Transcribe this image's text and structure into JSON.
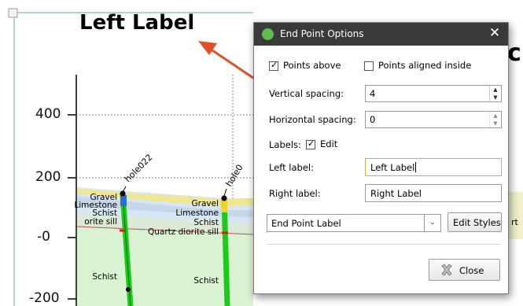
{
  "background": {
    "left_label": "Left Label",
    "right_title_fragment": "c",
    "far_right_fragment": "rt",
    "y_ticks": [
      "400",
      "200",
      "-0",
      "-200"
    ],
    "hole_labels": [
      "hole022",
      "hole0"
    ],
    "strata_left": [
      "Gravel",
      "Limestone",
      "Schist",
      "orite sill",
      "Schist"
    ],
    "strata_right": [
      "Gravel",
      "Limestone",
      "Schist",
      "Quartz diorite sill",
      "Schist"
    ],
    "colors": {
      "annotation_arrow": "#e0502a",
      "gravel": "#f2e68a",
      "limestone": "#c9d6ea",
      "schist_band": "#d5e7f4",
      "lower_schist": "#d9f2d1",
      "drillhole": "#1ec91e",
      "sill_line": "#d22020",
      "frame_border": "#a8d8d2"
    }
  },
  "dialog": {
    "title": "End Point Options",
    "close_glyph": "✕",
    "points_above_label": "Points above",
    "points_above_checked": true,
    "points_aligned_label": "Points aligned inside",
    "points_aligned_checked": false,
    "vertical_spacing_label": "Vertical spacing:",
    "vertical_spacing_value": "4",
    "horizontal_spacing_label": "Horizontal spacing:",
    "horizontal_spacing_value": "0",
    "labels_label": "Labels:",
    "edit_label": "Edit",
    "edit_checked": true,
    "left_label_label": "Left label:",
    "left_label_value": "Left Label",
    "right_label_label": "Right label:",
    "right_label_value": "Right Label",
    "style_selected": "End Point Label",
    "edit_styles_label": "Edit Styles",
    "close_label": "Close",
    "check_glyph": "✓",
    "dropdown_glyph": "⌄",
    "spin_up_glyph": "▲",
    "spin_down_glyph": "▼"
  }
}
